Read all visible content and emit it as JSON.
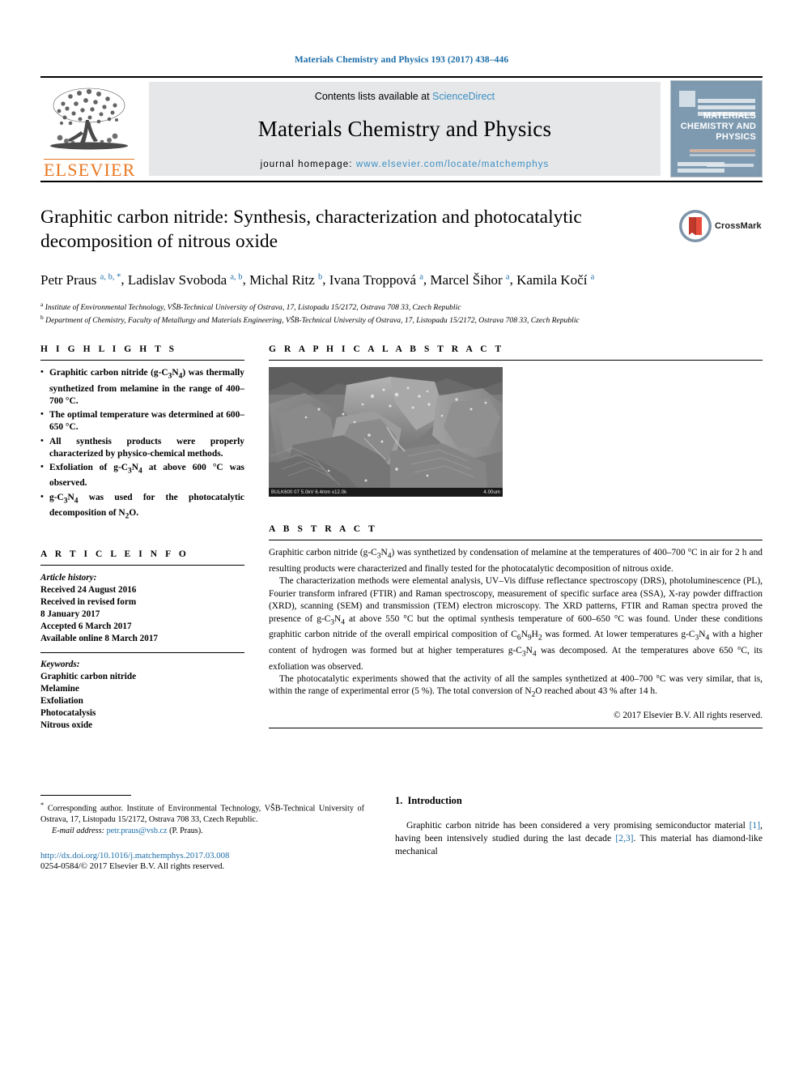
{
  "running_head": "Materials Chemistry and Physics 193 (2017) 438–446",
  "banner": {
    "publisher_name": "ELSEVIER",
    "publisher_logo_icon": "elsevier-tree-icon",
    "contents_prefix": "Contents lists available at ",
    "contents_link": "ScienceDirect",
    "journal_title": "Materials Chemistry and Physics",
    "homepage_label": "journal homepage: ",
    "homepage_url": "www.elsevier.com/locate/matchemphys",
    "cover_title": "MATERIALS CHEMISTRY AND PHYSICS",
    "link_color": "#3a8fc4"
  },
  "article": {
    "title": "Graphitic carbon nitride: Synthesis, characterization and photocatalytic decomposition of nitrous oxide",
    "crossmark_label": "CrossMark",
    "crossmark_icon": "crossmark-badge-icon",
    "authors": [
      {
        "name": "Petr Praus",
        "marks": "a, b, *"
      },
      {
        "name": "Ladislav Svoboda",
        "marks": "a, b"
      },
      {
        "name": "Michal Ritz",
        "marks": "b"
      },
      {
        "name": "Ivana Troppová",
        "marks": "a"
      },
      {
        "name": "Marcel Šihor",
        "marks": "a"
      },
      {
        "name": "Kamila Kočí",
        "marks": "a"
      }
    ],
    "affiliations": [
      {
        "mark": "a",
        "text": "Institute of Environmental Technology, VŠB-Technical University of Ostrava, 17, Listopadu 15/2172, Ostrava 708 33, Czech Republic"
      },
      {
        "mark": "b",
        "text": "Department of Chemistry, Faculty of Metallurgy and Materials Engineering, VŠB-Technical University of Ostrava, 17, Listopadu 15/2172, Ostrava 708 33, Czech Republic"
      }
    ]
  },
  "highlights": {
    "heading": "H I G H L I G H T S",
    "items": [
      "Graphitic carbon nitride (g-C3N4) was thermally synthetized from melamine in the range of 400–700 °C.",
      "The optimal temperature was determined at 600–650 °C.",
      "All synthesis products were properly characterized by physico-chemical methods.",
      "Exfoliation of g-C3N4 at above 600 °C was observed.",
      "g-C3N4 was used for the photocatalytic decomposition of N2O."
    ]
  },
  "graphical_abstract": {
    "heading": "G R A P H I C A L   A B S T R A C T",
    "figure_alt": "sem-micrograph",
    "sem_caption_left": "BULK600 07 5.0kV 6.4mm x12.0k",
    "sem_caption_right": "4.00um"
  },
  "article_info": {
    "heading": "A R T I C L E   I N F O",
    "history_label": "Article history:",
    "history": [
      "Received 24 August 2016",
      "Received in revised form",
      "8 January 2017",
      "Accepted 6 March 2017",
      "Available online 8 March 2017"
    ],
    "keywords_label": "Keywords:",
    "keywords": [
      "Graphitic carbon nitride",
      "Melamine",
      "Exfoliation",
      "Photocatalysis",
      "Nitrous oxide"
    ]
  },
  "abstract": {
    "heading": "A B S T R A C T",
    "paragraphs": [
      "Graphitic carbon nitride (g-C3N4) was synthetized by condensation of melamine at the temperatures of 400–700 °C in air for 2 h and resulting products were characterized and finally tested for the photocatalytic decomposition of nitrous oxide.",
      "The characterization methods were elemental analysis, UV–Vis diffuse reflectance spectroscopy (DRS), photoluminescence (PL), Fourier transform infrared (FTIR) and Raman spectroscopy, measurement of specific surface area (SSA), X-ray powder diffraction (XRD), scanning (SEM) and transmission (TEM) electron microscopy. The XRD patterns, FTIR and Raman spectra proved the presence of g-C3N4 at above 550 °C but the optimal synthesis temperature of 600–650 °C was found. Under these conditions graphitic carbon nitride of the overall empirical composition of C6N9H2 was formed. At lower temperatures g-C3N4 with a higher content of hydrogen was formed but at higher temperatures g-C3N4 was decomposed. At the temperatures above 650 °C, its exfoliation was observed.",
      "The photocatalytic experiments showed that the activity of all the samples synthetized at 400–700 °C was very similar, that is, within the range of experimental error (5 %). The total conversion of N2O reached about 43 % after 14 h."
    ],
    "copyright": "© 2017 Elsevier B.V. All rights reserved."
  },
  "footer": {
    "corresponding_marker": "*",
    "corresponding_text": "Corresponding author. Institute of Environmental Technology, VŠB-Technical University of Ostrava, 17, Listopadu 15/2172, Ostrava 708 33, Czech Republic.",
    "email_label": "E-mail address:",
    "email": "petr.praus@vsb.cz",
    "email_owner": "(P. Praus).",
    "doi_url": "http://dx.doi.org/10.1016/j.matchemphys.2017.03.008",
    "issn_line": "0254-0584/© 2017 Elsevier B.V. All rights reserved."
  },
  "introduction": {
    "number": "1.",
    "heading": "Introduction",
    "text_part1": "Graphitic carbon nitride has been considered a very promising semiconductor material ",
    "cite1": "[1]",
    "text_part2": ", having been intensively studied during the last decade ",
    "cite2": "[2,3]",
    "text_part3": ". This material has diamond-like mechanical"
  }
}
